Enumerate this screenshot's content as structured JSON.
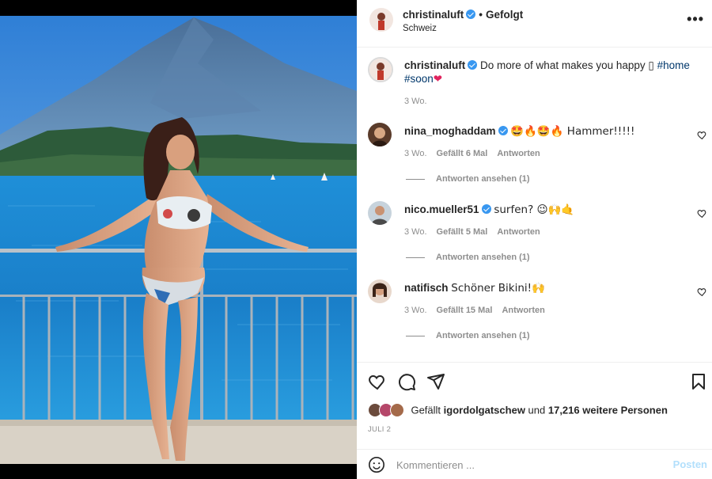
{
  "post": {
    "author": "christinaluft",
    "follow_state": "Gefolgt",
    "separator": "•",
    "location": "Schweiz"
  },
  "caption": {
    "username": "christinaluft",
    "text": "Do more of what makes you happy ▯ ",
    "hashtag_home": "#home",
    "hashtag_soon": "#soon",
    "heart": "❤",
    "time": "3 Wo."
  },
  "comments": [
    {
      "username": "nina_moghaddam",
      "text": "🤩🔥🤩🔥 Hammer!!!!!",
      "time": "3 Wo.",
      "likes": "Gefällt 6 Mal",
      "reply": "Antworten",
      "replies": "Antworten ansehen (1)"
    },
    {
      "username": "nico.mueller51",
      "text": "surfen? 😉🙌🤙",
      "time": "3 Wo.",
      "likes": "Gefällt 5 Mal",
      "reply": "Antworten",
      "replies": "Antworten ansehen (1)"
    },
    {
      "username": "natifisch",
      "text": "Schöner Bikini!🙌",
      "time": "3 Wo.",
      "likes": "Gefällt 15 Mal",
      "reply": "Antworten",
      "replies": "Antworten ansehen (1)"
    }
  ],
  "likes": {
    "prefix": "Gefällt ",
    "user": "igordolgatschew",
    "middle": " und ",
    "count": "17,216 weitere Personen"
  },
  "date": "JULI 2",
  "composer": {
    "placeholder": "Kommentieren ...",
    "post_label": "Posten"
  },
  "colors": {
    "verified": "#3897f0",
    "hashtag": "#00376b",
    "muted": "#8e8e8e",
    "post_disabled": "#b2dffc"
  },
  "icons": [
    "more-options-icon",
    "heart-icon",
    "comment-icon",
    "share-icon",
    "bookmark-icon",
    "emoji-icon",
    "verified-icon"
  ]
}
